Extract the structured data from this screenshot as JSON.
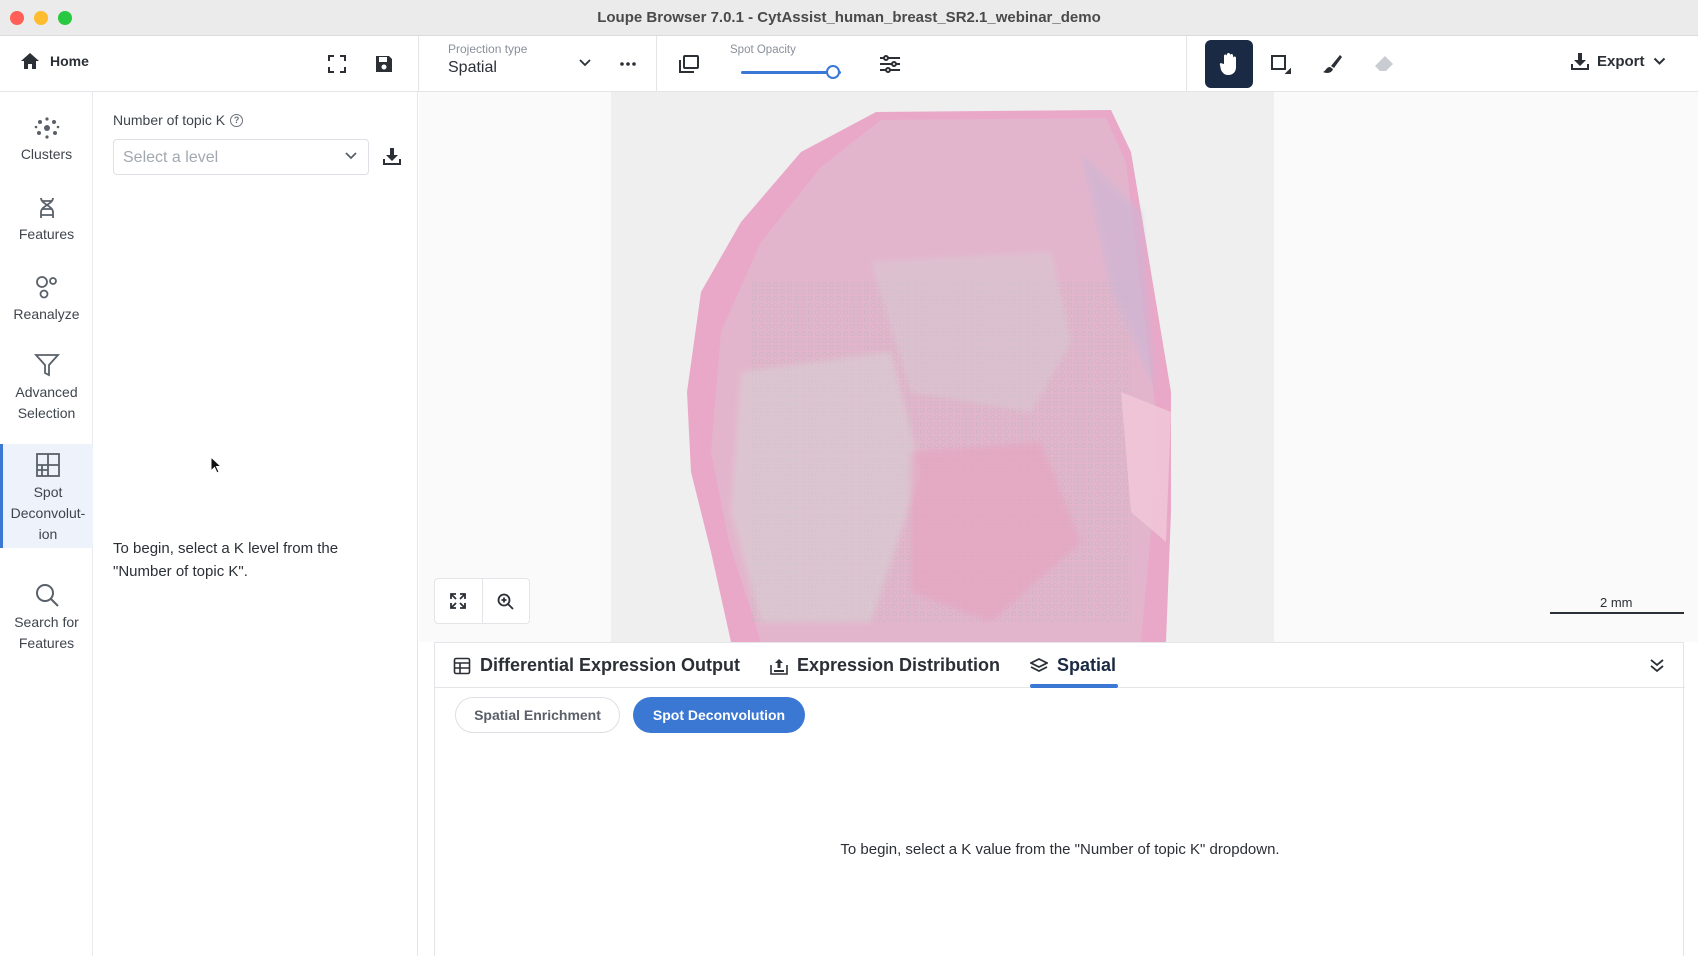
{
  "window": {
    "title": "Loupe Browser 7.0.1 - CytAssist_human_breast_SR2.1_webinar_demo"
  },
  "toolbar": {
    "home_label": "Home",
    "projection_label": "Projection type",
    "projection_value": "Spatial",
    "spot_opacity_label": "Spot Opacity",
    "spot_opacity_value": 0.92,
    "export_label": "Export"
  },
  "rail": {
    "items": [
      {
        "label": "Clusters",
        "icon": "clusters-icon"
      },
      {
        "label": "Features",
        "icon": "dna-icon"
      },
      {
        "label": "Reanalyze",
        "icon": "bubbles-icon"
      },
      {
        "label": "Advanced Selection",
        "icon": "filter-icon"
      },
      {
        "label": "Spot Deconvolut-ion",
        "icon": "grid-icon",
        "active": true
      },
      {
        "label": "Search for Features",
        "icon": "search-icon"
      }
    ]
  },
  "panel": {
    "topic_label": "Number of topic K",
    "select_placeholder": "Select a level",
    "message": "To begin, select a K level from the \"Number of topic K\"."
  },
  "viewer": {
    "scale_label": "2 mm"
  },
  "bottom": {
    "tabs": [
      {
        "label": "Differential Expression Output",
        "icon": "table-icon"
      },
      {
        "label": "Expression Distribution",
        "icon": "upload-chart-icon"
      },
      {
        "label": "Spatial",
        "icon": "layers-icon",
        "active": true
      }
    ],
    "subtabs": [
      {
        "label": "Spatial Enrichment"
      },
      {
        "label": "Spot Deconvolution",
        "active": true
      }
    ],
    "message": "To begin, select a K value from the \"Number of topic K\" dropdown."
  },
  "colors": {
    "accent": "#3a78d4",
    "dark": "#1a2a44",
    "tissue": "#e8a9c6"
  }
}
